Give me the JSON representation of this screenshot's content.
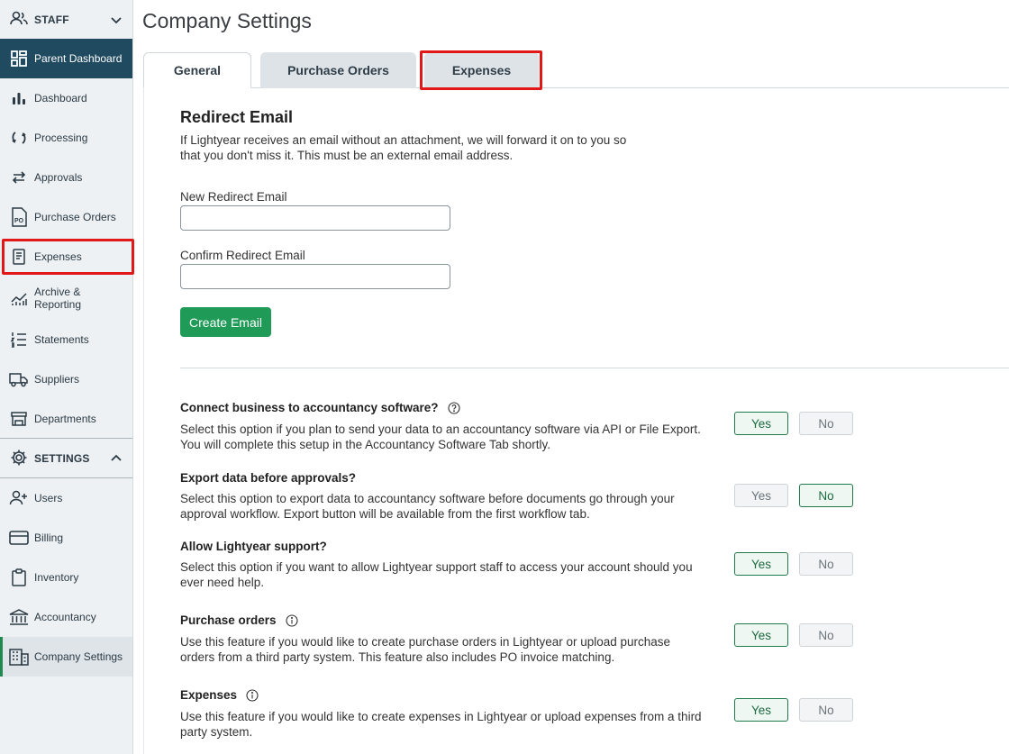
{
  "sidebar": {
    "staff_label": "STAFF",
    "settings_label": "SETTINGS",
    "items": [
      {
        "label": "Parent Dashboard"
      },
      {
        "label": "Dashboard"
      },
      {
        "label": "Processing"
      },
      {
        "label": "Approvals"
      },
      {
        "label": "Purchase Orders"
      },
      {
        "label": "Expenses"
      },
      {
        "label": "Archive &\nReporting"
      },
      {
        "label": "Statements"
      },
      {
        "label": "Suppliers"
      },
      {
        "label": "Departments"
      }
    ],
    "settings_items": [
      {
        "label": "Users"
      },
      {
        "label": "Billing"
      },
      {
        "label": "Inventory"
      },
      {
        "label": "Accountancy"
      },
      {
        "label": "Company Settings"
      }
    ]
  },
  "page": {
    "title": "Company Settings",
    "tabs": [
      {
        "label": "General"
      },
      {
        "label": "Purchase Orders"
      },
      {
        "label": "Expenses"
      }
    ]
  },
  "redirect": {
    "title": "Redirect Email",
    "desc": "If Lightyear receives an email without an attachment, we will forward it on to you so that you don't miss it. This must be an external email address.",
    "new_label": "New Redirect Email",
    "new_value": "",
    "confirm_label": "Confirm Redirect Email",
    "confirm_value": "",
    "create_button": "Create Email"
  },
  "options": [
    {
      "title": "Connect business to accountancy software?",
      "desc": "Select this option if you plan to send your data to an accountancy software via API or File Export. You will complete this setup in the Accountancy Software Tab shortly.",
      "selected": "Yes"
    },
    {
      "title": "Export data before approvals?",
      "desc": "Select this option to export data to accountancy software before documents go through your approval workflow. Export button will be available from the first workflow tab.",
      "selected": "No"
    },
    {
      "title": "Allow Lightyear support?",
      "desc": "Select this option if you want to allow Lightyear support staff to access your account should you ever need help.",
      "selected": "Yes"
    },
    {
      "title": "Purchase orders",
      "desc": "Use this feature if you would like to create purchase orders in Lightyear or upload purchase orders from a third party system. This feature also includes PO invoice matching.",
      "selected": "Yes"
    },
    {
      "title": "Expenses",
      "desc": "Use this feature if you would like to create expenses in Lightyear or upload expenses from a third party system.",
      "selected": "Yes"
    }
  ],
  "yes_label": "Yes",
  "no_label": "No",
  "colors": {
    "accent": "#1f9a57",
    "sidebar_active": "#1f4a60",
    "highlight": "#e01818"
  }
}
